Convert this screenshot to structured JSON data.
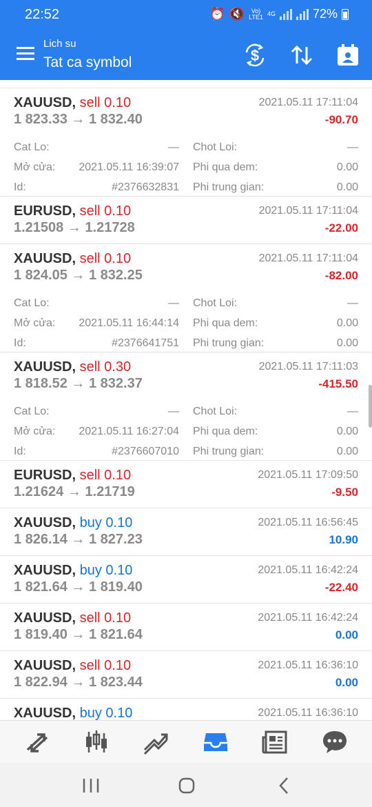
{
  "status_bar": {
    "time": "22:52",
    "carrier_top": "Vo)",
    "carrier_bottom": "LTE1",
    "network": "4G",
    "battery": "72%"
  },
  "toolbar": {
    "subtitle": "Lich su",
    "title": "Tat ca symbol",
    "icons": [
      "menu-icon",
      "currency-exchange-icon",
      "sort-icon",
      "calendar-icon"
    ]
  },
  "labels": {
    "sl": "Cat Lo:",
    "tp": "Chot Loi:",
    "open": "Mở cửa:",
    "swap": "Phi qua dem:",
    "id": "Id:",
    "commission": "Phi trung gian:"
  },
  "deals": [
    {
      "symbol": "XAUUSD,",
      "type": "sell",
      "volume": "0.10",
      "datetime": "2021.05.11 17:11:04",
      "prices": "1 823.33 → 1 832.40",
      "profit": "-90.70",
      "profit_sign": "neg",
      "details": {
        "sl": "—",
        "tp": "—",
        "open_time": "2021.05.11 16:39:07",
        "swap": "0.00",
        "id": "#2376632831",
        "commission": "0.00"
      }
    },
    {
      "symbol": "EURUSD,",
      "type": "sell",
      "volume": "0.10",
      "datetime": "2021.05.11 17:11:04",
      "prices": "1.21508 → 1.21728",
      "profit": "-22.00",
      "profit_sign": "neg"
    },
    {
      "symbol": "XAUUSD,",
      "type": "sell",
      "volume": "0.10",
      "datetime": "2021.05.11 17:11:04",
      "prices": "1 824.05 → 1 832.25",
      "profit": "-82.00",
      "profit_sign": "neg",
      "details": {
        "sl": "—",
        "tp": "—",
        "open_time": "2021.05.11 16:44:14",
        "swap": "0.00",
        "id": "#2376641751",
        "commission": "0.00"
      }
    },
    {
      "symbol": "XAUUSD,",
      "type": "sell",
      "volume": "0.30",
      "datetime": "2021.05.11 17:11:03",
      "prices": "1 818.52 → 1 832.37",
      "profit": "-415.50",
      "profit_sign": "neg",
      "details": {
        "sl": "—",
        "tp": "—",
        "open_time": "2021.05.11 16:27:04",
        "swap": "0.00",
        "id": "#2376607010",
        "commission": "0.00"
      }
    },
    {
      "symbol": "EURUSD,",
      "type": "sell",
      "volume": "0.10",
      "datetime": "2021.05.11 17:09:50",
      "prices": "1.21624 → 1.21719",
      "profit": "-9.50",
      "profit_sign": "neg"
    },
    {
      "symbol": "XAUUSD,",
      "type": "buy",
      "volume": "0.10",
      "datetime": "2021.05.11 16:56:45",
      "prices": "1 826.14 → 1 827.23",
      "profit": "10.90",
      "profit_sign": "pos"
    },
    {
      "symbol": "XAUUSD,",
      "type": "buy",
      "volume": "0.10",
      "datetime": "2021.05.11 16:42:24",
      "prices": "1 821.64 → 1 819.40",
      "profit": "-22.40",
      "profit_sign": "neg"
    },
    {
      "symbol": "XAUUSD,",
      "type": "sell",
      "volume": "0.10",
      "datetime": "2021.05.11 16:42:24",
      "prices": "1 819.40 → 1 821.64",
      "profit": "0.00",
      "profit_sign": "pos"
    },
    {
      "symbol": "XAUUSD,",
      "type": "sell",
      "volume": "0.10",
      "datetime": "2021.05.11 16:36:10",
      "prices": "1 822.94 → 1 823.44",
      "profit": "0.00",
      "profit_sign": "pos"
    },
    {
      "symbol": "XAUUSD,",
      "type": "buy",
      "volume": "0.10",
      "datetime": "2021.05.11 16:36:10",
      "prices": "",
      "profit": "",
      "profit_sign": "pos"
    }
  ],
  "bottom_nav": [
    {
      "icon": "quotes-icon",
      "active": false
    },
    {
      "icon": "chart-icon",
      "active": false
    },
    {
      "icon": "trade-icon",
      "active": false
    },
    {
      "icon": "history-icon",
      "active": true
    },
    {
      "icon": "news-icon",
      "active": false
    },
    {
      "icon": "messages-icon",
      "active": false
    }
  ],
  "colors": {
    "header": "#2a7fef",
    "sell": "#d7262b",
    "buy": "#1874d6",
    "active_nav": "#2a7fef",
    "inactive_nav": "#555555"
  }
}
